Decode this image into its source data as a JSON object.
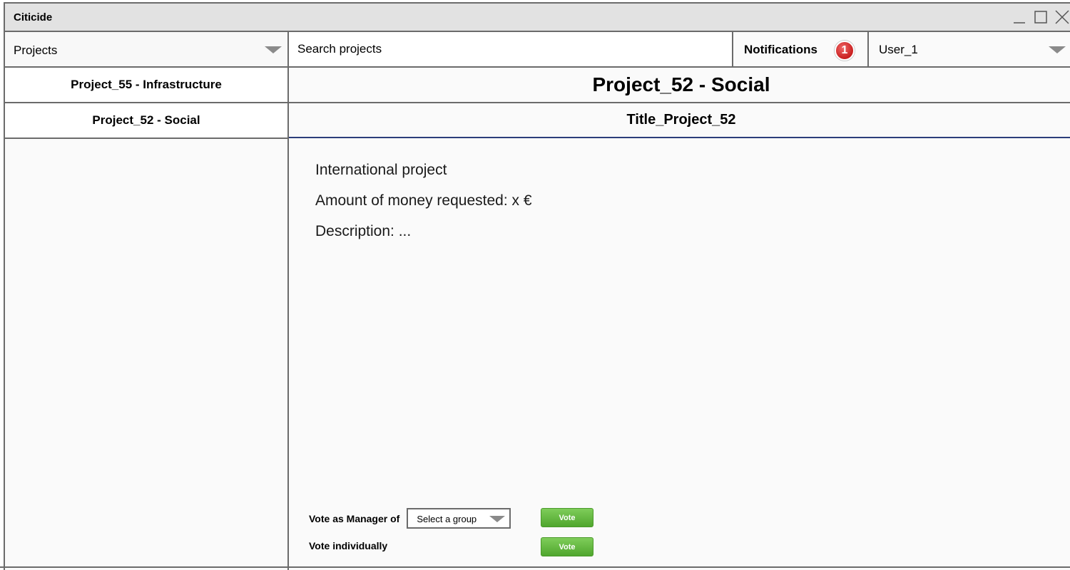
{
  "window": {
    "title": "Citicide"
  },
  "toolbar": {
    "projects_label": "Projects",
    "search_placeholder": "Search projects",
    "notifications_label": "Notifications",
    "notifications_count": "1",
    "user_label": "User_1"
  },
  "sidebar": {
    "items": [
      {
        "label": "Project_55 - Infrastructure"
      },
      {
        "label": "Project_52 - Social"
      }
    ]
  },
  "main": {
    "title": "Project_52 - Social",
    "subtitle": "Title_Project_52",
    "details": {
      "type": "International project",
      "amount": "Amount of money requested: x €",
      "description": "Description: ..."
    },
    "vote": {
      "manager_label": "Vote as Manager of",
      "group_placeholder": "Select a group",
      "individual_label": "Vote individually",
      "button_label": "Vote"
    }
  },
  "colors": {
    "border": "#6b6b6b",
    "accent_line": "#2c3e7b",
    "vote_button": "#5cb536",
    "badge": "#d42a2a"
  }
}
